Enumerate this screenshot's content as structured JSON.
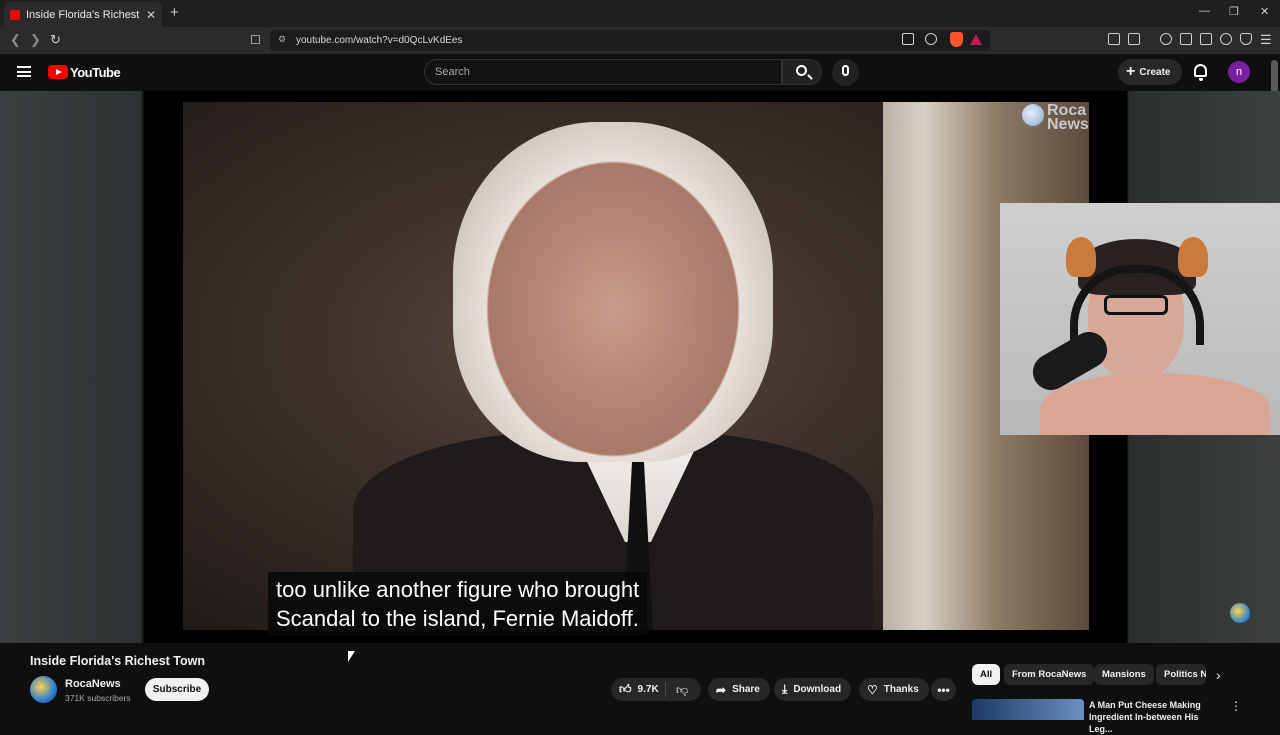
{
  "browser": {
    "tab_title": "Inside Florida's Richest Town - Y",
    "tab_close": "✕",
    "new_tab": "+",
    "url": "youtube.com/watch?v=d0QcLvKdEes",
    "window_min": "—",
    "window_max": "❐",
    "window_close": "✕"
  },
  "youtube": {
    "logo_text": "YouTube",
    "search_placeholder": "Search",
    "create_label": "Create",
    "avatar_letter": "n"
  },
  "player": {
    "watermark_line1": "Roca",
    "watermark_line2": "News",
    "caption_line1": "too unlike another figure who brought",
    "caption_line2": "Scandal to the island, Fernie Maidoff."
  },
  "video": {
    "title": "Inside Florida's Richest Town",
    "channel_name": "RocaNews",
    "subscribers": "371K subscribers",
    "subscribe_label": "Subscribe",
    "likes": "9.7K",
    "share_label": "Share",
    "download_label": "Download",
    "thanks_label": "Thanks",
    "more_label": "•••"
  },
  "sidebar": {
    "chips": [
      "All",
      "From RocaNews",
      "Mansions",
      "Politics N"
    ],
    "next_arrow": "›",
    "rec_title": "A Man Put Cheese Making Ingredient In-between His Leg...",
    "rec_more": "⋮"
  },
  "colors": {
    "background": "#0f0f0f",
    "brand_red": "#ff0000",
    "avatar_purple": "#7b1fa2"
  }
}
